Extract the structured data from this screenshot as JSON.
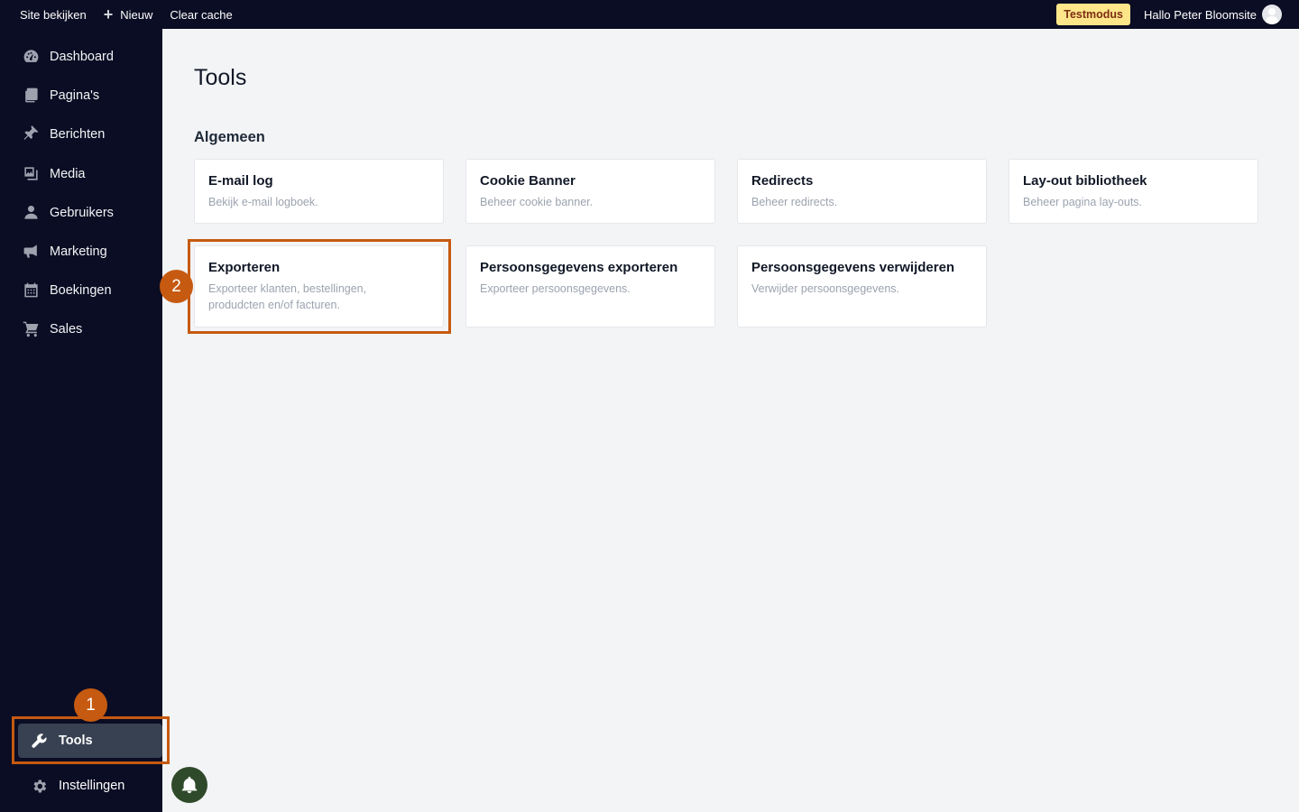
{
  "topbar": {
    "view_site": "Site bekijken",
    "new": "Nieuw",
    "clear_cache": "Clear cache",
    "test_mode": "Testmodus",
    "greeting": "Hallo Peter Bloomsite"
  },
  "sidebar": {
    "items": [
      {
        "label": "Dashboard",
        "icon": "dashboard-icon"
      },
      {
        "label": "Pagina's",
        "icon": "pages-icon"
      },
      {
        "label": "Berichten",
        "icon": "pin-icon"
      },
      {
        "label": "Media",
        "icon": "media-icon"
      },
      {
        "label": "Gebruikers",
        "icon": "user-icon"
      },
      {
        "label": "Marketing",
        "icon": "megaphone-icon"
      },
      {
        "label": "Boekingen",
        "icon": "calendar-icon"
      },
      {
        "label": "Sales",
        "icon": "cart-icon"
      }
    ],
    "tools": "Tools",
    "settings": "Instellingen"
  },
  "main": {
    "title": "Tools",
    "section": "Algemeen",
    "cards": [
      {
        "title": "E-mail log",
        "desc": "Bekijk e-mail logboek."
      },
      {
        "title": "Cookie Banner",
        "desc": "Beheer cookie banner."
      },
      {
        "title": "Redirects",
        "desc": "Beheer redirects."
      },
      {
        "title": "Lay-out bibliotheek",
        "desc": "Beheer pagina lay-outs."
      },
      {
        "title": "Exporteren",
        "desc": "Exporteer klanten, bestellingen, produdcten en/of facturen."
      },
      {
        "title": "Persoonsgegevens exporteren",
        "desc": "Exporteer persoonsgegevens."
      },
      {
        "title": "Persoonsgegevens verwijderen",
        "desc": "Verwijder persoonsgegevens."
      }
    ]
  },
  "annotations": {
    "step1": "1",
    "step2": "2",
    "highlight_color": "#c65a11"
  },
  "colors": {
    "sidebar_bg": "#0b0d24",
    "test_badge_bg": "#fde68a",
    "bell_bg": "#2f4a2a"
  }
}
